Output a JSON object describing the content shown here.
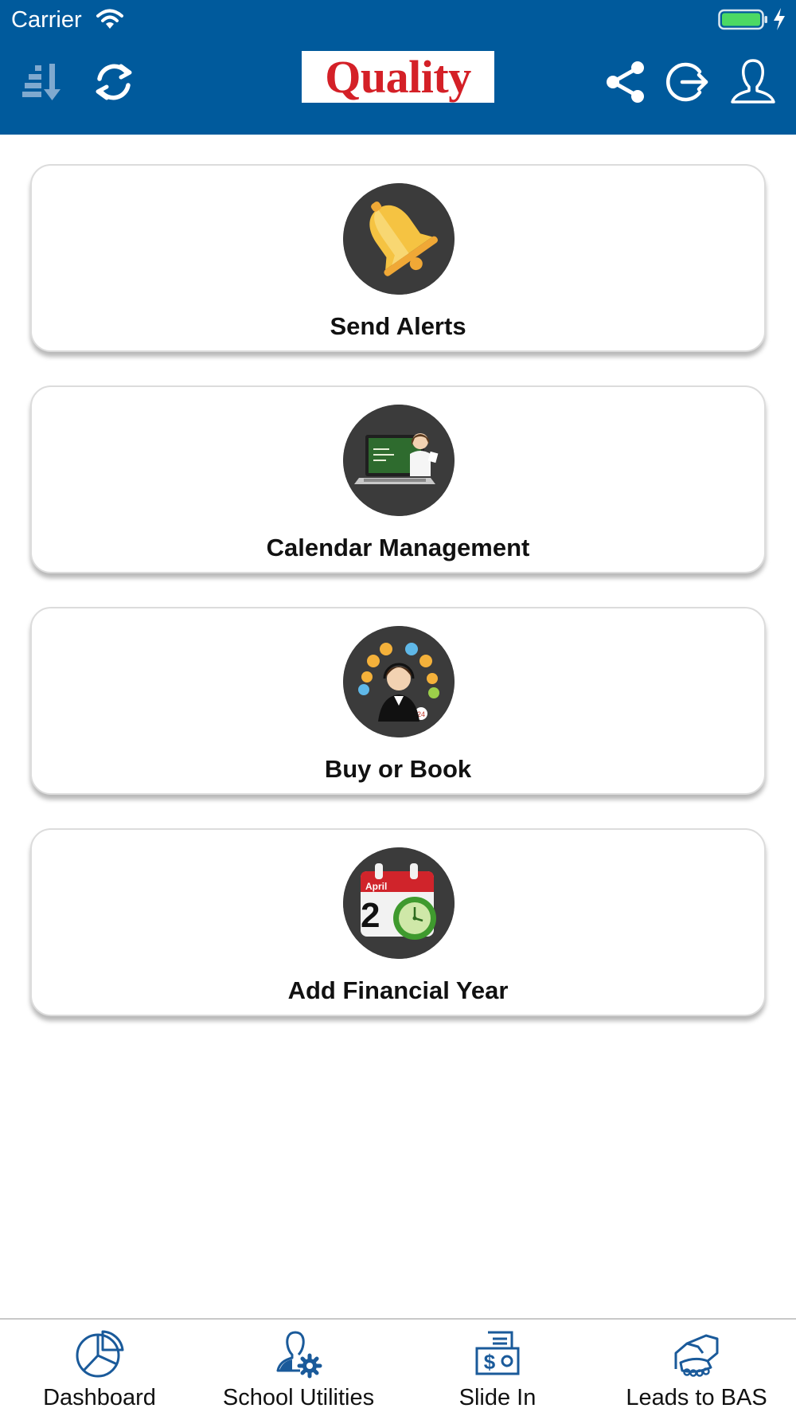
{
  "status_bar": {
    "carrier": "Carrier",
    "wifi_icon": "wifi-icon",
    "battery_icon": "battery-charging-icon"
  },
  "header": {
    "background": "#005a9c",
    "logo_text": "Quality",
    "logo_color": "#d42027",
    "left_icons": [
      "sort-descending-icon",
      "refresh-icon"
    ],
    "right_icons": [
      "share-icon",
      "logout-icon",
      "user-profile-icon"
    ]
  },
  "menu": {
    "items": [
      {
        "label": "Send Alerts",
        "icon": "bell-icon"
      },
      {
        "label": "Calendar Management",
        "icon": "online-education-icon"
      },
      {
        "label": "Buy or Book",
        "icon": "customer-support-icon"
      },
      {
        "label": "Add Financial Year",
        "icon": "calendar-clock-icon",
        "icon_text": "April",
        "icon_number": "2"
      }
    ]
  },
  "tabbar": {
    "accent": "#1a5a9a",
    "tabs": [
      {
        "label": "Dashboard",
        "icon": "pie-chart-icon"
      },
      {
        "label": "School Utilities",
        "icon": "user-settings-icon"
      },
      {
        "label": "Slide In",
        "icon": "receipt-dollar-icon"
      },
      {
        "label": "Leads to BAS",
        "icon": "handshake-icon"
      }
    ]
  }
}
